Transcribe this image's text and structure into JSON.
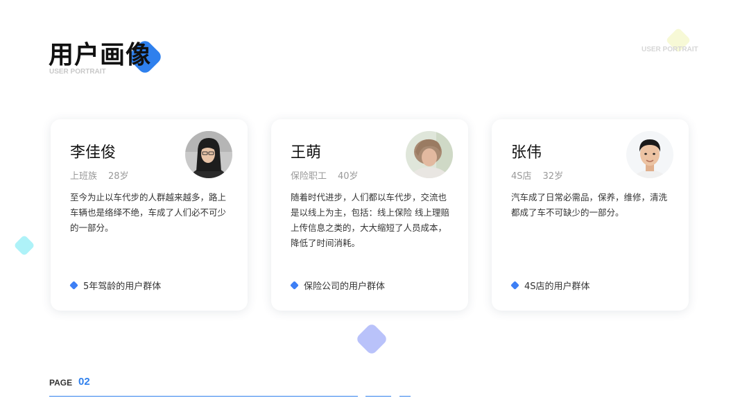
{
  "header": {
    "title": "用户画像",
    "subtitle": "USER PORTRAIT",
    "corner_subtitle": "USER PORTRAIT"
  },
  "cards": [
    {
      "name": "李佳俊",
      "occupation": "上班族",
      "age": "28岁",
      "description": "至今为止以车代步的人群越来越多，路上车辆也是络绎不绝，车成了人们必不可少的一部分。",
      "tag": "5年驾龄的用户群体",
      "avatar_icon": "woman-glasses-avatar"
    },
    {
      "name": "王萌",
      "occupation": "保险职工",
      "age": "40岁",
      "description": "随着时代进步，人们都以车代步，交流也是以线上为主，包括：线上保险 线上理赔 上传信息之类的，大大缩短了人员成本，降低了时间消耗。",
      "tag": "保险公司的用户群体",
      "avatar_icon": "older-woman-avatar"
    },
    {
      "name": "张伟",
      "occupation": "4S店",
      "age": "32岁",
      "description": "汽车成了日常必需品，保养，维修，清洗都成了车不可缺少的一部分。",
      "tag": "4S店的用户群体",
      "avatar_icon": "young-man-avatar"
    }
  ],
  "footer": {
    "page_label": "PAGE",
    "page_number": "02"
  },
  "colors": {
    "accent": "#2f80ed",
    "tag_dot": "#3d7ff5",
    "deco_cyan": "#aef2f8",
    "deco_purple": "#b9c2fa",
    "deco_yellow": "#f7f9d6"
  }
}
